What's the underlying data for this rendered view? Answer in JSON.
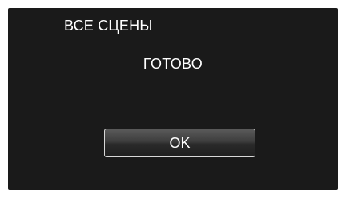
{
  "dialog": {
    "title": "ВСЕ СЦЕНЫ",
    "message": "ГОТОВО",
    "ok_label": "OK"
  },
  "colors": {
    "background": "#1a1a1a",
    "text": "#ffffff",
    "button_border": "#d8d8d8"
  }
}
